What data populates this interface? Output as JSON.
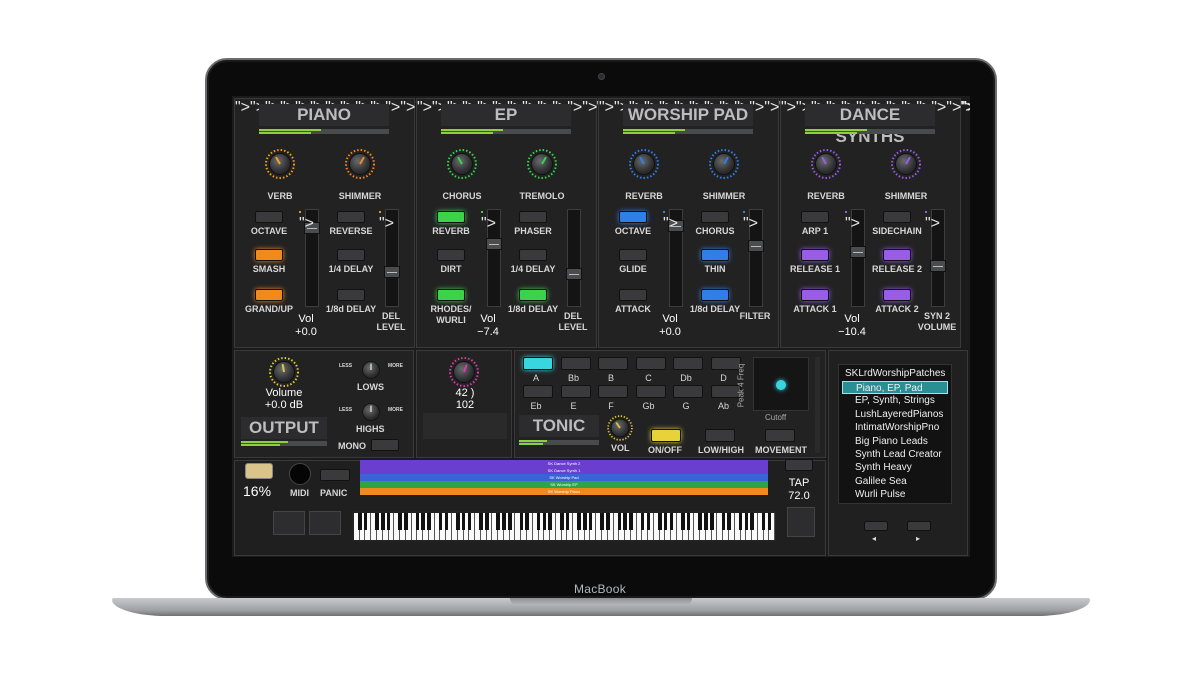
{
  "brand": "MacBook",
  "sections": [
    {
      "title": "PIANO",
      "knobs": [
        "VERB",
        "SHIMMER"
      ],
      "buttons_left": [
        "OCTAVE",
        "SMASH",
        "GRAND/UP"
      ],
      "buttons_right": [
        "REVERSE",
        "1/4 DELAY",
        "1/8d DELAY"
      ],
      "vol_label": "Vol",
      "vol_value": "+0.0",
      "fader2_label": "DEL\nLEVEL",
      "accent": "#f08a1c"
    },
    {
      "title": "EP",
      "knobs": [
        "CHORUS",
        "TREMOLO"
      ],
      "buttons_left": [
        "REVERB",
        "DIRT",
        "RHODES/\nWURLI"
      ],
      "buttons_right": [
        "PHASER",
        "1/4 DELAY",
        "1/8d DELAY"
      ],
      "vol_label": "Vol",
      "vol_value": "−7.4",
      "fader2_label": "DEL\nLEVEL",
      "accent": "#3cd24a"
    },
    {
      "title": "WORSHIP PAD",
      "knobs": [
        "REVERB",
        "SHIMMER"
      ],
      "buttons_left": [
        "OCTAVE",
        "GLIDE",
        "ATTACK"
      ],
      "buttons_right": [
        "CHORUS",
        "THIN",
        "1/8d DELAY"
      ],
      "vol_label": "Vol",
      "vol_value": "+0.0",
      "fader2_label": "FILTER",
      "accent": "#2f7fe6"
    },
    {
      "title": "DANCE SYNTHS",
      "knobs": [
        "REVERB",
        "SHIMMER"
      ],
      "buttons_left": [
        "ARP 1",
        "RELEASE 1",
        "ATTACK 1"
      ],
      "buttons_right": [
        "SIDECHAIN",
        "RELEASE 2",
        "ATTACK 2"
      ],
      "vol_label": "Vol",
      "vol_value": "−10.4",
      "fader2_label": "SYN 2\nVOLUME",
      "accent": "#9a5ce6"
    }
  ],
  "output": {
    "title": "OUTPUT",
    "volume_label": "Volume",
    "volume_value": "+0.0 dB",
    "lows": "LOWS",
    "highs": "HIGHS",
    "less": "LESS",
    "more": "MORE",
    "mono": "MONO"
  },
  "middle": {
    "value1": "42 )",
    "value2": "102"
  },
  "tonic": {
    "title": "TONIC",
    "keys_row1": [
      "A",
      "Bb",
      "B",
      "C",
      "Db",
      "D"
    ],
    "keys_row2": [
      "Eb",
      "E",
      "F",
      "Gb",
      "G",
      "Ab"
    ],
    "selected_key": "A",
    "vol": "VOL",
    "onoff": "ON/OFF",
    "lowhigh": "LOW/HIGH",
    "movement": "MOVEMENT",
    "cutoff": "Cutoff",
    "peak": "Peak 4 Freq"
  },
  "bottom": {
    "cpu": "16%",
    "midi": "MIDI",
    "panic": "PANIC",
    "tap": "TAP",
    "tempo": "72.0"
  },
  "layer_bars": [
    {
      "label": "SK Dance Synth 2",
      "color": "#6a3fd0"
    },
    {
      "label": "SK Dance Synth 1",
      "color": "#6a3fd0"
    },
    {
      "label": "SK Worship Pad",
      "color": "#3a63d8"
    },
    {
      "label": "SK Worship EP",
      "color": "#2fa347"
    },
    {
      "label": "SK Worship Piano",
      "color": "#ef8a1e"
    }
  ],
  "presets": {
    "header": "SKLrdWorshipPatches",
    "items": [
      "Piano, EP, Pad",
      "EP, Synth, Strings",
      "LushLayeredPianos",
      "IntimatWorshipPno",
      "Big Piano Leads",
      "Synth Lead Creator",
      "Synth Heavy",
      "Galilee Sea",
      "Wurli Pulse"
    ],
    "selected": 0,
    "prev": "◂",
    "next": "▸"
  }
}
